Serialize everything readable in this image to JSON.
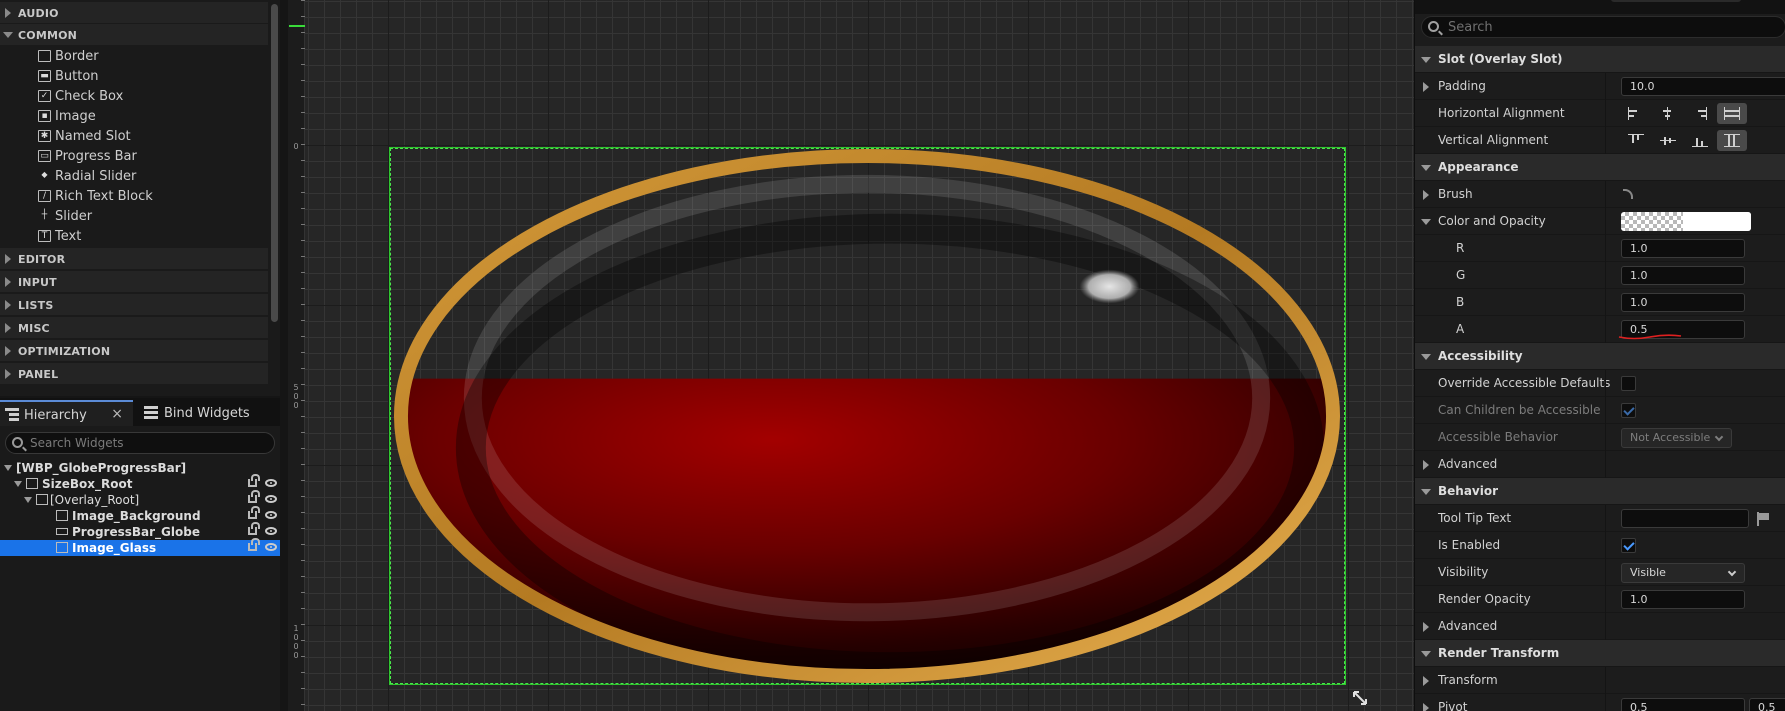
{
  "palette": {
    "categories_top": [
      {
        "label": "AUDIO",
        "expanded": false
      },
      {
        "label": "COMMON",
        "expanded": true
      }
    ],
    "common_items": [
      {
        "label": "Border",
        "icon": "border-icon"
      },
      {
        "label": "Button",
        "icon": "button-icon"
      },
      {
        "label": "Check Box",
        "icon": "checkbox-icon"
      },
      {
        "label": "Image",
        "icon": "image-icon"
      },
      {
        "label": "Named Slot",
        "icon": "named-slot-icon"
      },
      {
        "label": "Progress Bar",
        "icon": "progress-bar-icon"
      },
      {
        "label": "Radial Slider",
        "icon": "radial-slider-icon"
      },
      {
        "label": "Rich Text Block",
        "icon": "rich-text-icon"
      },
      {
        "label": "Slider",
        "icon": "slider-icon"
      },
      {
        "label": "Text",
        "icon": "text-icon"
      }
    ],
    "categories_bottom": [
      "EDITOR",
      "INPUT",
      "LISTS",
      "MISC",
      "OPTIMIZATION",
      "PANEL"
    ]
  },
  "hierarchy": {
    "tabs": [
      {
        "label": "Hierarchy",
        "active": true
      },
      {
        "label": "Bind Widgets",
        "active": false
      }
    ],
    "close_label": "×",
    "search_placeholder": "Search Widgets",
    "tree": [
      {
        "label": "[WBP_GlobeProgressBar]",
        "depth": 0,
        "selected": false
      },
      {
        "label": "SizeBox_Root",
        "depth": 1,
        "selected": false
      },
      {
        "label": "[Overlay_Root]",
        "depth": 2,
        "selected": false
      },
      {
        "label": "Image_Background",
        "depth": 3,
        "selected": false
      },
      {
        "label": "ProgressBar_Globe",
        "depth": 3,
        "selected": false
      },
      {
        "label": "Image_Glass",
        "depth": 3,
        "selected": true
      }
    ]
  },
  "canvas": {
    "ruler_labels": [
      "0",
      "5\n0\n0",
      "1\n0\n0\n0"
    ],
    "widget_fill_percent": 57,
    "fill_color": "#8b0000",
    "frame_color": "#49e84a"
  },
  "details": {
    "search_placeholder": "Search",
    "rows": [
      {
        "kind": "section",
        "label": "Slot (Overlay Slot)"
      },
      {
        "kind": "text",
        "label": "Padding",
        "value": "10.0",
        "expandable": true
      },
      {
        "kind": "align-h",
        "label": "Horizontal Alignment"
      },
      {
        "kind": "align-v",
        "label": "Vertical Alignment"
      },
      {
        "kind": "section",
        "label": "Appearance"
      },
      {
        "kind": "brush",
        "label": "Brush",
        "expandable": true
      },
      {
        "kind": "color",
        "label": "Color and Opacity",
        "expanded": true
      },
      {
        "kind": "num",
        "label": "R",
        "value": "1.0",
        "sub": true
      },
      {
        "kind": "num",
        "label": "G",
        "value": "1.0",
        "sub": true
      },
      {
        "kind": "num",
        "label": "B",
        "value": "1.0",
        "sub": true
      },
      {
        "kind": "num",
        "label": "A",
        "value": "0.5",
        "sub": true
      },
      {
        "kind": "section",
        "label": "Accessibility"
      },
      {
        "kind": "check",
        "label": "Override Accessible Defaults",
        "checked": false
      },
      {
        "kind": "check",
        "label": "Can Children be Accessible",
        "checked": true,
        "disabled": true
      },
      {
        "kind": "combo",
        "label": "Accessible Behavior",
        "value": "Not Accessible",
        "disabled": true
      },
      {
        "kind": "plain",
        "label": "Advanced",
        "expandable": true
      },
      {
        "kind": "section",
        "label": "Behavior"
      },
      {
        "kind": "tooltip",
        "label": "Tool Tip Text",
        "value": ""
      },
      {
        "kind": "check",
        "label": "Is Enabled",
        "checked": true
      },
      {
        "kind": "combo",
        "label": "Visibility",
        "value": "Visible"
      },
      {
        "kind": "num",
        "label": "Render Opacity",
        "value": "1.0"
      },
      {
        "kind": "plain",
        "label": "Advanced",
        "expandable": true
      },
      {
        "kind": "section",
        "label": "Render Transform"
      },
      {
        "kind": "plain",
        "label": "Transform",
        "expandable": true
      },
      {
        "kind": "pivot",
        "label": "Pivot",
        "value": "0.5",
        "value2": "0.5",
        "expandable": true
      }
    ]
  }
}
